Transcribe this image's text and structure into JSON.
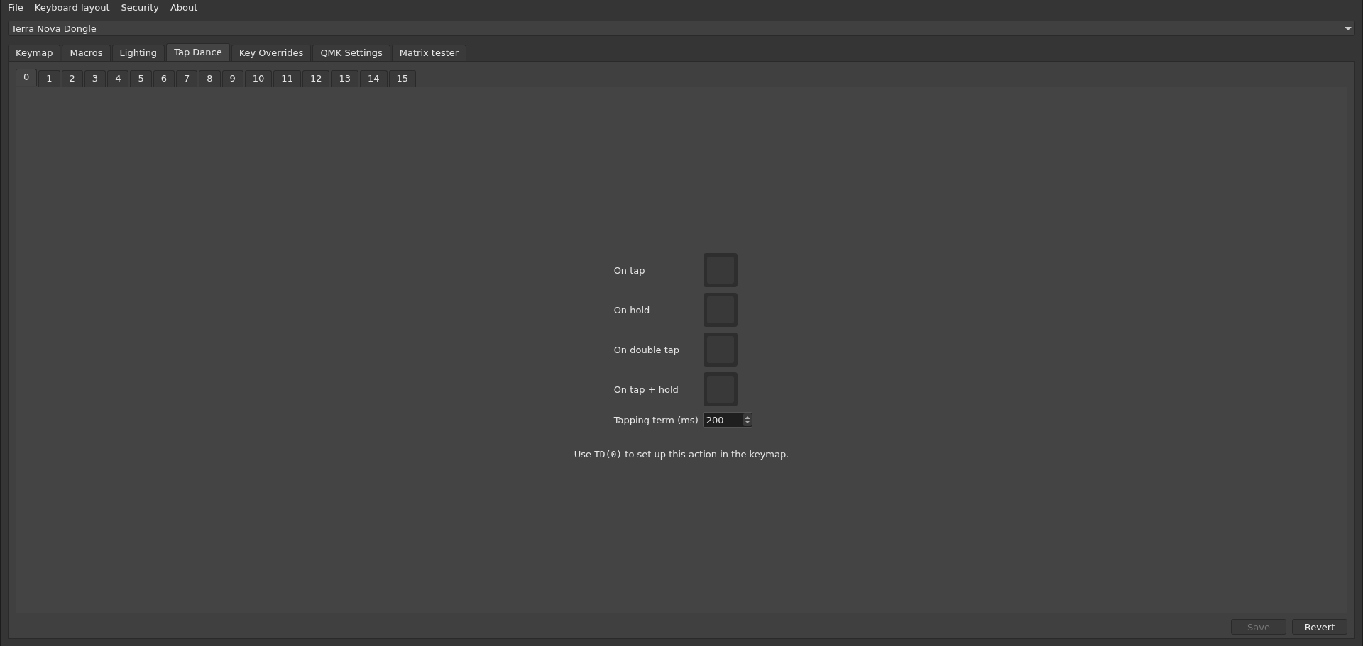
{
  "menu": [
    {
      "label": "File"
    },
    {
      "label": "Keyboard layout"
    },
    {
      "label": "Security"
    },
    {
      "label": "About"
    }
  ],
  "device_select": {
    "value": "Terra Nova Dongle"
  },
  "tabs": [
    {
      "label": "Keymap",
      "selected": false
    },
    {
      "label": "Macros",
      "selected": false
    },
    {
      "label": "Lighting",
      "selected": false
    },
    {
      "label": "Tap Dance",
      "selected": true
    },
    {
      "label": "Key Overrides",
      "selected": false
    },
    {
      "label": "QMK Settings",
      "selected": false
    },
    {
      "label": "Matrix tester",
      "selected": false
    }
  ],
  "entry_tabs": [
    {
      "label": "0",
      "selected": true
    },
    {
      "label": "1",
      "selected": false
    },
    {
      "label": "2",
      "selected": false
    },
    {
      "label": "3",
      "selected": false
    },
    {
      "label": "4",
      "selected": false
    },
    {
      "label": "5",
      "selected": false
    },
    {
      "label": "6",
      "selected": false
    },
    {
      "label": "7",
      "selected": false
    },
    {
      "label": "8",
      "selected": false
    },
    {
      "label": "9",
      "selected": false
    },
    {
      "label": "10",
      "selected": false
    },
    {
      "label": "11",
      "selected": false
    },
    {
      "label": "12",
      "selected": false
    },
    {
      "label": "13",
      "selected": false
    },
    {
      "label": "14",
      "selected": false
    },
    {
      "label": "15",
      "selected": false
    }
  ],
  "actions": [
    {
      "label": "On tap"
    },
    {
      "label": "On hold"
    },
    {
      "label": "On double tap"
    },
    {
      "label": "On tap + hold"
    }
  ],
  "tapping_term": {
    "label": "Tapping term (ms)",
    "value": "200"
  },
  "note": {
    "before": "Use ",
    "code": "TD(0)",
    "after": " to set up this action in the keymap."
  },
  "buttons": [
    {
      "label": "Save",
      "disabled": true
    },
    {
      "label": "Revert",
      "disabled": false
    }
  ]
}
